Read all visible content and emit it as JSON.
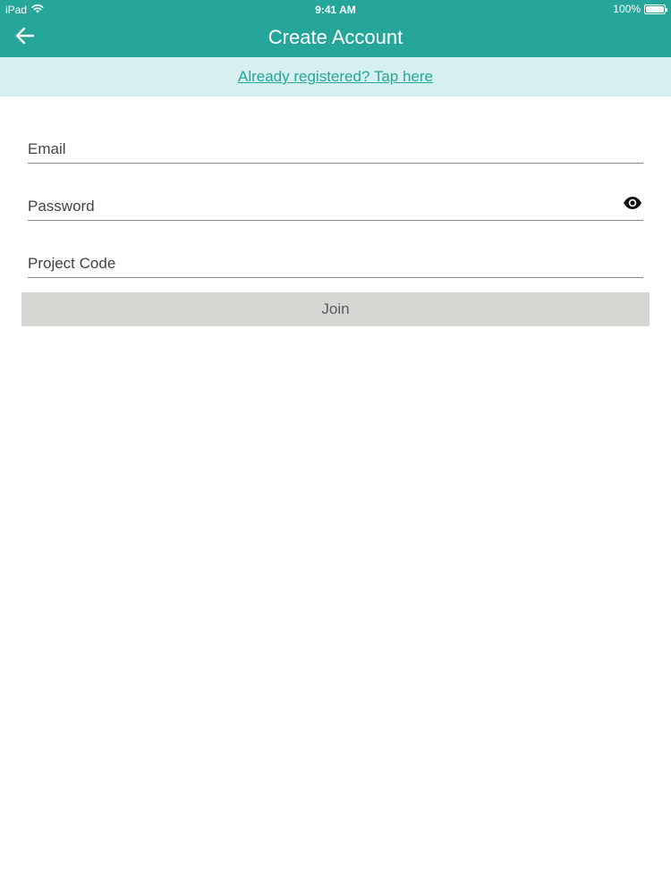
{
  "status_bar": {
    "device": "iPad",
    "wifi_icon": "wifi-icon",
    "time": "9:41 AM",
    "battery_percent": "100%",
    "battery_level": 1.0
  },
  "app_bar": {
    "back_icon": "arrow-left-icon",
    "title": "Create Account"
  },
  "banner": {
    "link_text": "Already registered? Tap here"
  },
  "form": {
    "email": {
      "placeholder": "Email",
      "value": ""
    },
    "password": {
      "placeholder": "Password",
      "value": "",
      "visibility_icon": "eye-icon"
    },
    "project_code": {
      "placeholder": "Project Code",
      "value": ""
    },
    "join_label": "Join"
  },
  "colors": {
    "primary": "#26a69a",
    "banner_bg": "#d5f0ee",
    "button_bg": "#d6d6d2",
    "button_text": "#5a5a5a"
  }
}
